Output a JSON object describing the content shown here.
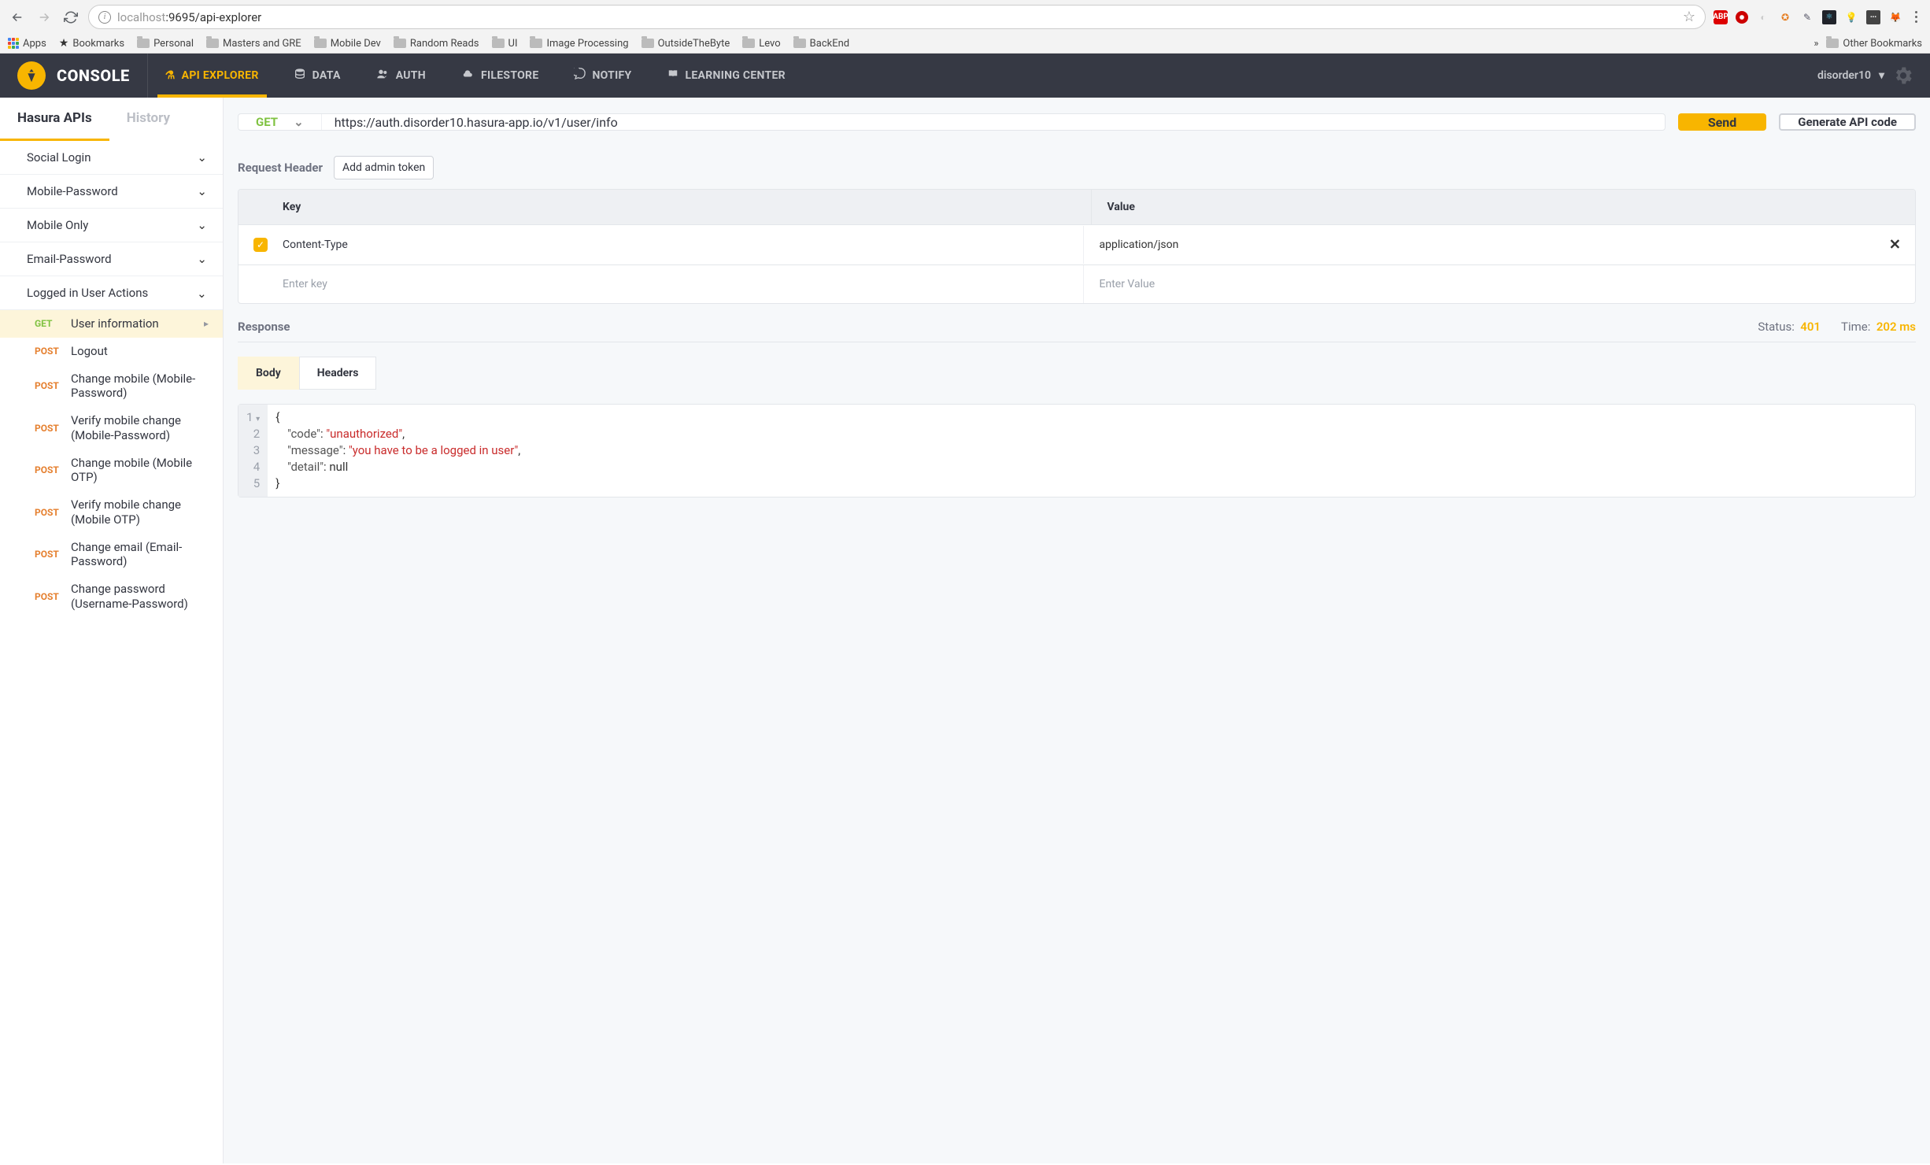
{
  "browser": {
    "url_host": "localhost",
    "url_port_path": ":9695/api-explorer",
    "bookmark_bar": [
      "Apps",
      "Bookmarks",
      "Personal",
      "Masters and GRE",
      "Mobile Dev",
      "Random Reads",
      "UI",
      "Image Processing",
      "OutsideTheByte",
      "Levo",
      "BackEnd"
    ],
    "other_bookmarks": "Other Bookmarks"
  },
  "topbar": {
    "console": "CONSOLE",
    "nav": [
      {
        "label": "API EXPLORER",
        "icon": "flask",
        "active": true
      },
      {
        "label": "DATA",
        "icon": "database"
      },
      {
        "label": "AUTH",
        "icon": "users"
      },
      {
        "label": "FILESTORE",
        "icon": "cloud"
      },
      {
        "label": "NOTIFY",
        "icon": "chat"
      },
      {
        "label": "LEARNING CENTER",
        "icon": "book"
      }
    ],
    "user": "disorder10"
  },
  "sidebar": {
    "tabs": [
      {
        "label": "Hasura APIs",
        "active": true
      },
      {
        "label": "History"
      }
    ],
    "groups": [
      {
        "label": "Social Login",
        "open": false
      },
      {
        "label": "Mobile-Password",
        "open": false
      },
      {
        "label": "Mobile Only",
        "open": false
      },
      {
        "label": "Email-Password",
        "open": false
      },
      {
        "label": "Logged in User Actions",
        "open": true,
        "items": [
          {
            "method": "GET",
            "label": "User information",
            "selected": true
          },
          {
            "method": "POST",
            "label": "Logout"
          },
          {
            "method": "POST",
            "label": "Change mobile (Mobile-Password)"
          },
          {
            "method": "POST",
            "label": "Verify mobile change (Mobile-Password)"
          },
          {
            "method": "POST",
            "label": "Change mobile (Mobile OTP)"
          },
          {
            "method": "POST",
            "label": "Verify mobile change (Mobile OTP)"
          },
          {
            "method": "POST",
            "label": "Change email (Email-Password)"
          },
          {
            "method": "POST",
            "label": "Change password (Username-Password)"
          }
        ]
      }
    ]
  },
  "request": {
    "method": "GET",
    "url": "https://auth.disorder10.hasura-app.io/v1/user/info",
    "send_label": "Send",
    "generate_label": "Generate API code"
  },
  "headers_section": {
    "title": "Request Header",
    "add_admin": "Add admin token",
    "cols": {
      "key": "Key",
      "value": "Value"
    },
    "rows": [
      {
        "checked": true,
        "key": "Content-Type",
        "value": "application/json",
        "removable": true
      }
    ],
    "placeholders": {
      "key": "Enter key",
      "value": "Enter Value"
    }
  },
  "response": {
    "title": "Response",
    "status_label": "Status:",
    "status_value": "401",
    "time_label": "Time:",
    "time_value": "202 ms",
    "tabs": [
      {
        "label": "Body",
        "active": true
      },
      {
        "label": "Headers"
      }
    ],
    "body": {
      "code": "unauthorized",
      "message": "you have to be a logged in user",
      "detail": null
    }
  }
}
